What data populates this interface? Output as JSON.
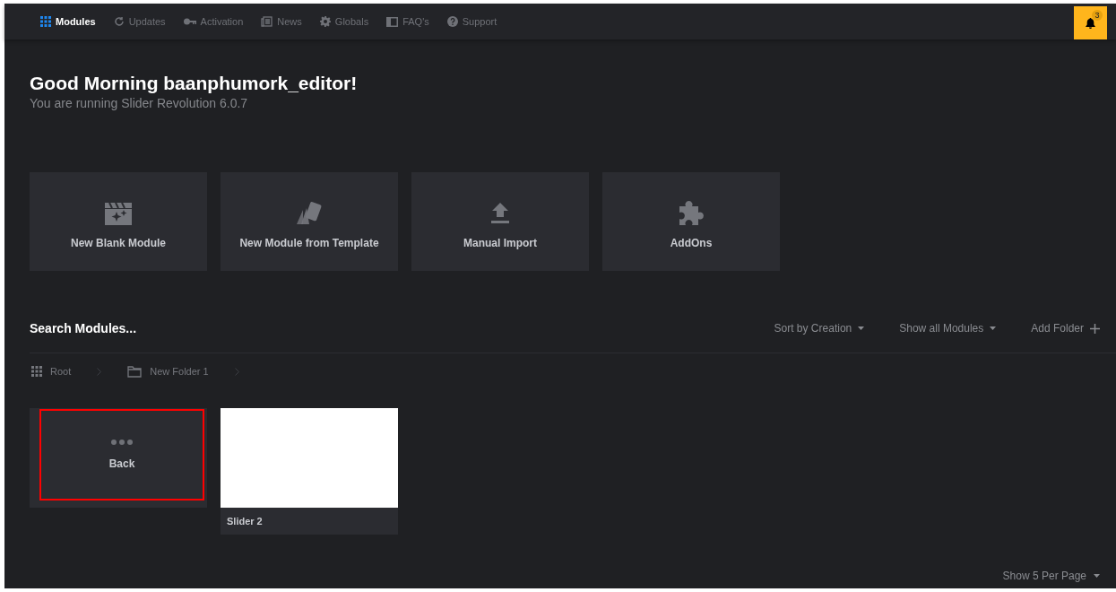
{
  "nav": {
    "items": [
      {
        "label": "Modules",
        "selected": true
      },
      {
        "label": "Updates",
        "selected": false
      },
      {
        "label": "Activation",
        "selected": false
      },
      {
        "label": "News",
        "selected": false
      },
      {
        "label": "Globals",
        "selected": false
      },
      {
        "label": "FAQ's",
        "selected": false
      },
      {
        "label": "Support",
        "selected": false
      }
    ],
    "notifications": {
      "count": "3"
    }
  },
  "greeting": {
    "title": "Good Morning baanphumork_editor!",
    "subtitle": "You are running Slider Revolution 6.0.7"
  },
  "actions": [
    {
      "label": "New Blank Module"
    },
    {
      "label": "New Module from Template"
    },
    {
      "label": "Manual Import"
    },
    {
      "label": "AddOns"
    }
  ],
  "toolbar": {
    "title": "Search Modules...",
    "sort": "Sort by Creation",
    "filter": "Show all Modules",
    "add_folder": "Add Folder"
  },
  "breadcrumbs": [
    {
      "label": "Root"
    },
    {
      "label": "New Folder 1"
    }
  ],
  "modules": [
    {
      "kind": "back",
      "label": "Back",
      "highlighted": true
    },
    {
      "kind": "slider",
      "label": "Slider 2",
      "highlighted": false
    }
  ],
  "pagination": {
    "per_page": "Show 5 Per Page"
  }
}
